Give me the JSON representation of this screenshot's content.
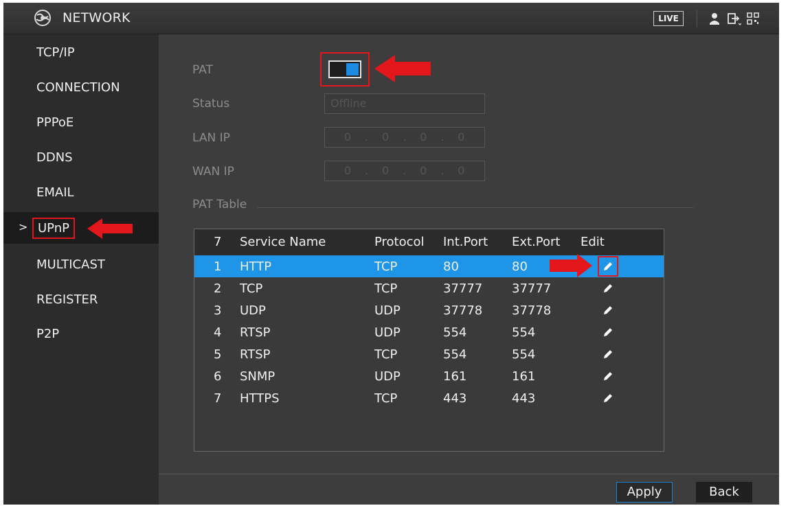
{
  "header": {
    "title": "NETWORK",
    "live_label": "LIVE"
  },
  "sidebar": {
    "items": [
      {
        "label": "TCP/IP"
      },
      {
        "label": "CONNECTION"
      },
      {
        "label": "PPPoE"
      },
      {
        "label": "DDNS"
      },
      {
        "label": "EMAIL"
      },
      {
        "label": "UPnP"
      },
      {
        "label": "MULTICAST"
      },
      {
        "label": "REGISTER"
      },
      {
        "label": "P2P"
      }
    ],
    "active_chevron": ">"
  },
  "form": {
    "pat_label": "PAT",
    "pat_enabled": true,
    "status_label": "Status",
    "status_value": "Offline",
    "lan_ip_label": "LAN IP",
    "lan_ip": [
      "0",
      "0",
      "0",
      "0"
    ],
    "wan_ip_label": "WAN IP",
    "wan_ip": [
      "0",
      "0",
      "0",
      "0"
    ],
    "pat_table_label": "PAT Table"
  },
  "table": {
    "headers": {
      "no": "7",
      "name": "Service Name",
      "protocol": "Protocol",
      "int_port": "Int.Port",
      "ext_port": "Ext.Port",
      "edit": "Edit"
    },
    "rows": [
      {
        "no": "1",
        "name": "HTTP",
        "protocol": "TCP",
        "int_port": "80",
        "ext_port": "80"
      },
      {
        "no": "2",
        "name": "TCP",
        "protocol": "TCP",
        "int_port": "37777",
        "ext_port": "37777"
      },
      {
        "no": "3",
        "name": "UDP",
        "protocol": "UDP",
        "int_port": "37778",
        "ext_port": "37778"
      },
      {
        "no": "4",
        "name": "RTSP",
        "protocol": "UDP",
        "int_port": "554",
        "ext_port": "554"
      },
      {
        "no": "5",
        "name": "RTSP",
        "protocol": "TCP",
        "int_port": "554",
        "ext_port": "554"
      },
      {
        "no": "6",
        "name": "SNMP",
        "protocol": "UDP",
        "int_port": "161",
        "ext_port": "161"
      },
      {
        "no": "7",
        "name": "HTTPS",
        "protocol": "TCP",
        "int_port": "443",
        "ext_port": "443"
      }
    ],
    "selected_row": 0
  },
  "buttons": {
    "apply": "Apply",
    "back": "Back"
  },
  "colors": {
    "accent": "#1f95e8",
    "annotation": "#e3161b",
    "sidebar_bg": "#2c2c2c",
    "main_bg": "#3d3d3d"
  },
  "icons": [
    "globe-icon",
    "user-icon",
    "logout-icon",
    "qr-code-icon",
    "pencil-edit-icon",
    "red-arrow-annotation"
  ]
}
